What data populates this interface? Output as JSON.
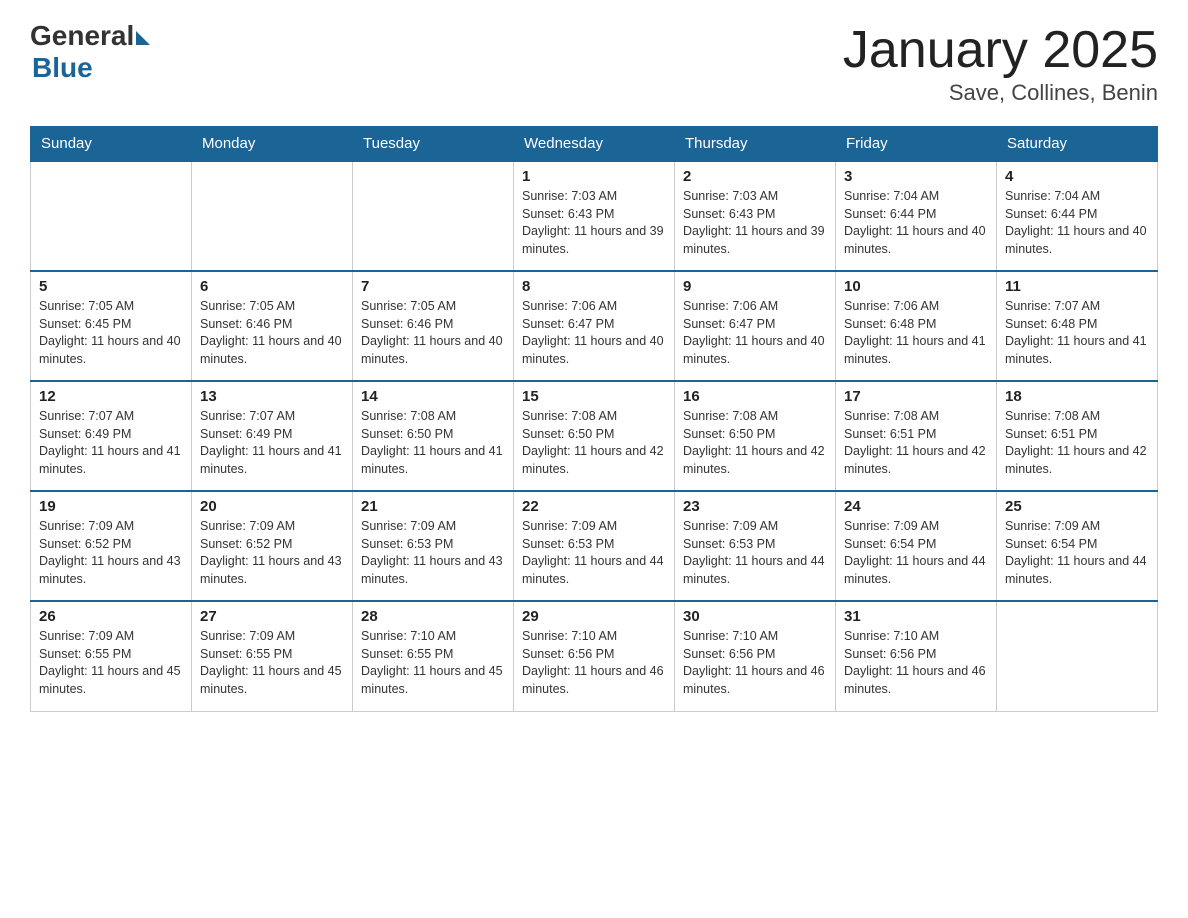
{
  "logo": {
    "general": "General",
    "blue": "Blue"
  },
  "title": {
    "month": "January 2025",
    "location": "Save, Collines, Benin"
  },
  "headers": [
    "Sunday",
    "Monday",
    "Tuesday",
    "Wednesday",
    "Thursday",
    "Friday",
    "Saturday"
  ],
  "weeks": [
    [
      {
        "day": "",
        "info": ""
      },
      {
        "day": "",
        "info": ""
      },
      {
        "day": "",
        "info": ""
      },
      {
        "day": "1",
        "info": "Sunrise: 7:03 AM\nSunset: 6:43 PM\nDaylight: 11 hours and 39 minutes."
      },
      {
        "day": "2",
        "info": "Sunrise: 7:03 AM\nSunset: 6:43 PM\nDaylight: 11 hours and 39 minutes."
      },
      {
        "day": "3",
        "info": "Sunrise: 7:04 AM\nSunset: 6:44 PM\nDaylight: 11 hours and 40 minutes."
      },
      {
        "day": "4",
        "info": "Sunrise: 7:04 AM\nSunset: 6:44 PM\nDaylight: 11 hours and 40 minutes."
      }
    ],
    [
      {
        "day": "5",
        "info": "Sunrise: 7:05 AM\nSunset: 6:45 PM\nDaylight: 11 hours and 40 minutes."
      },
      {
        "day": "6",
        "info": "Sunrise: 7:05 AM\nSunset: 6:46 PM\nDaylight: 11 hours and 40 minutes."
      },
      {
        "day": "7",
        "info": "Sunrise: 7:05 AM\nSunset: 6:46 PM\nDaylight: 11 hours and 40 minutes."
      },
      {
        "day": "8",
        "info": "Sunrise: 7:06 AM\nSunset: 6:47 PM\nDaylight: 11 hours and 40 minutes."
      },
      {
        "day": "9",
        "info": "Sunrise: 7:06 AM\nSunset: 6:47 PM\nDaylight: 11 hours and 40 minutes."
      },
      {
        "day": "10",
        "info": "Sunrise: 7:06 AM\nSunset: 6:48 PM\nDaylight: 11 hours and 41 minutes."
      },
      {
        "day": "11",
        "info": "Sunrise: 7:07 AM\nSunset: 6:48 PM\nDaylight: 11 hours and 41 minutes."
      }
    ],
    [
      {
        "day": "12",
        "info": "Sunrise: 7:07 AM\nSunset: 6:49 PM\nDaylight: 11 hours and 41 minutes."
      },
      {
        "day": "13",
        "info": "Sunrise: 7:07 AM\nSunset: 6:49 PM\nDaylight: 11 hours and 41 minutes."
      },
      {
        "day": "14",
        "info": "Sunrise: 7:08 AM\nSunset: 6:50 PM\nDaylight: 11 hours and 41 minutes."
      },
      {
        "day": "15",
        "info": "Sunrise: 7:08 AM\nSunset: 6:50 PM\nDaylight: 11 hours and 42 minutes."
      },
      {
        "day": "16",
        "info": "Sunrise: 7:08 AM\nSunset: 6:50 PM\nDaylight: 11 hours and 42 minutes."
      },
      {
        "day": "17",
        "info": "Sunrise: 7:08 AM\nSunset: 6:51 PM\nDaylight: 11 hours and 42 minutes."
      },
      {
        "day": "18",
        "info": "Sunrise: 7:08 AM\nSunset: 6:51 PM\nDaylight: 11 hours and 42 minutes."
      }
    ],
    [
      {
        "day": "19",
        "info": "Sunrise: 7:09 AM\nSunset: 6:52 PM\nDaylight: 11 hours and 43 minutes."
      },
      {
        "day": "20",
        "info": "Sunrise: 7:09 AM\nSunset: 6:52 PM\nDaylight: 11 hours and 43 minutes."
      },
      {
        "day": "21",
        "info": "Sunrise: 7:09 AM\nSunset: 6:53 PM\nDaylight: 11 hours and 43 minutes."
      },
      {
        "day": "22",
        "info": "Sunrise: 7:09 AM\nSunset: 6:53 PM\nDaylight: 11 hours and 44 minutes."
      },
      {
        "day": "23",
        "info": "Sunrise: 7:09 AM\nSunset: 6:53 PM\nDaylight: 11 hours and 44 minutes."
      },
      {
        "day": "24",
        "info": "Sunrise: 7:09 AM\nSunset: 6:54 PM\nDaylight: 11 hours and 44 minutes."
      },
      {
        "day": "25",
        "info": "Sunrise: 7:09 AM\nSunset: 6:54 PM\nDaylight: 11 hours and 44 minutes."
      }
    ],
    [
      {
        "day": "26",
        "info": "Sunrise: 7:09 AM\nSunset: 6:55 PM\nDaylight: 11 hours and 45 minutes."
      },
      {
        "day": "27",
        "info": "Sunrise: 7:09 AM\nSunset: 6:55 PM\nDaylight: 11 hours and 45 minutes."
      },
      {
        "day": "28",
        "info": "Sunrise: 7:10 AM\nSunset: 6:55 PM\nDaylight: 11 hours and 45 minutes."
      },
      {
        "day": "29",
        "info": "Sunrise: 7:10 AM\nSunset: 6:56 PM\nDaylight: 11 hours and 46 minutes."
      },
      {
        "day": "30",
        "info": "Sunrise: 7:10 AM\nSunset: 6:56 PM\nDaylight: 11 hours and 46 minutes."
      },
      {
        "day": "31",
        "info": "Sunrise: 7:10 AM\nSunset: 6:56 PM\nDaylight: 11 hours and 46 minutes."
      },
      {
        "day": "",
        "info": ""
      }
    ]
  ]
}
